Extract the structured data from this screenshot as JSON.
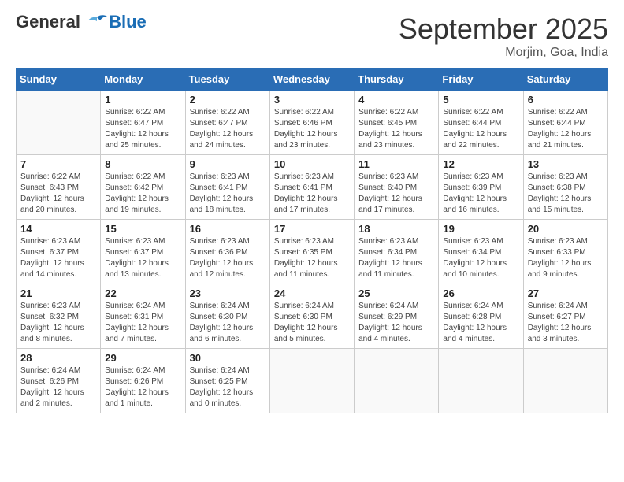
{
  "header": {
    "logo_line1": "General",
    "logo_line2": "Blue",
    "month_title": "September 2025",
    "location": "Morjim, Goa, India"
  },
  "days_of_week": [
    "Sunday",
    "Monday",
    "Tuesday",
    "Wednesday",
    "Thursday",
    "Friday",
    "Saturday"
  ],
  "weeks": [
    [
      {
        "day": "",
        "info": ""
      },
      {
        "day": "1",
        "info": "Sunrise: 6:22 AM\nSunset: 6:47 PM\nDaylight: 12 hours\nand 25 minutes."
      },
      {
        "day": "2",
        "info": "Sunrise: 6:22 AM\nSunset: 6:47 PM\nDaylight: 12 hours\nand 24 minutes."
      },
      {
        "day": "3",
        "info": "Sunrise: 6:22 AM\nSunset: 6:46 PM\nDaylight: 12 hours\nand 23 minutes."
      },
      {
        "day": "4",
        "info": "Sunrise: 6:22 AM\nSunset: 6:45 PM\nDaylight: 12 hours\nand 23 minutes."
      },
      {
        "day": "5",
        "info": "Sunrise: 6:22 AM\nSunset: 6:44 PM\nDaylight: 12 hours\nand 22 minutes."
      },
      {
        "day": "6",
        "info": "Sunrise: 6:22 AM\nSunset: 6:44 PM\nDaylight: 12 hours\nand 21 minutes."
      }
    ],
    [
      {
        "day": "7",
        "info": "Sunrise: 6:22 AM\nSunset: 6:43 PM\nDaylight: 12 hours\nand 20 minutes."
      },
      {
        "day": "8",
        "info": "Sunrise: 6:22 AM\nSunset: 6:42 PM\nDaylight: 12 hours\nand 19 minutes."
      },
      {
        "day": "9",
        "info": "Sunrise: 6:23 AM\nSunset: 6:41 PM\nDaylight: 12 hours\nand 18 minutes."
      },
      {
        "day": "10",
        "info": "Sunrise: 6:23 AM\nSunset: 6:41 PM\nDaylight: 12 hours\nand 17 minutes."
      },
      {
        "day": "11",
        "info": "Sunrise: 6:23 AM\nSunset: 6:40 PM\nDaylight: 12 hours\nand 17 minutes."
      },
      {
        "day": "12",
        "info": "Sunrise: 6:23 AM\nSunset: 6:39 PM\nDaylight: 12 hours\nand 16 minutes."
      },
      {
        "day": "13",
        "info": "Sunrise: 6:23 AM\nSunset: 6:38 PM\nDaylight: 12 hours\nand 15 minutes."
      }
    ],
    [
      {
        "day": "14",
        "info": "Sunrise: 6:23 AM\nSunset: 6:37 PM\nDaylight: 12 hours\nand 14 minutes."
      },
      {
        "day": "15",
        "info": "Sunrise: 6:23 AM\nSunset: 6:37 PM\nDaylight: 12 hours\nand 13 minutes."
      },
      {
        "day": "16",
        "info": "Sunrise: 6:23 AM\nSunset: 6:36 PM\nDaylight: 12 hours\nand 12 minutes."
      },
      {
        "day": "17",
        "info": "Sunrise: 6:23 AM\nSunset: 6:35 PM\nDaylight: 12 hours\nand 11 minutes."
      },
      {
        "day": "18",
        "info": "Sunrise: 6:23 AM\nSunset: 6:34 PM\nDaylight: 12 hours\nand 11 minutes."
      },
      {
        "day": "19",
        "info": "Sunrise: 6:23 AM\nSunset: 6:34 PM\nDaylight: 12 hours\nand 10 minutes."
      },
      {
        "day": "20",
        "info": "Sunrise: 6:23 AM\nSunset: 6:33 PM\nDaylight: 12 hours\nand 9 minutes."
      }
    ],
    [
      {
        "day": "21",
        "info": "Sunrise: 6:23 AM\nSunset: 6:32 PM\nDaylight: 12 hours\nand 8 minutes."
      },
      {
        "day": "22",
        "info": "Sunrise: 6:24 AM\nSunset: 6:31 PM\nDaylight: 12 hours\nand 7 minutes."
      },
      {
        "day": "23",
        "info": "Sunrise: 6:24 AM\nSunset: 6:30 PM\nDaylight: 12 hours\nand 6 minutes."
      },
      {
        "day": "24",
        "info": "Sunrise: 6:24 AM\nSunset: 6:30 PM\nDaylight: 12 hours\nand 5 minutes."
      },
      {
        "day": "25",
        "info": "Sunrise: 6:24 AM\nSunset: 6:29 PM\nDaylight: 12 hours\nand 4 minutes."
      },
      {
        "day": "26",
        "info": "Sunrise: 6:24 AM\nSunset: 6:28 PM\nDaylight: 12 hours\nand 4 minutes."
      },
      {
        "day": "27",
        "info": "Sunrise: 6:24 AM\nSunset: 6:27 PM\nDaylight: 12 hours\nand 3 minutes."
      }
    ],
    [
      {
        "day": "28",
        "info": "Sunrise: 6:24 AM\nSunset: 6:26 PM\nDaylight: 12 hours\nand 2 minutes."
      },
      {
        "day": "29",
        "info": "Sunrise: 6:24 AM\nSunset: 6:26 PM\nDaylight: 12 hours\nand 1 minute."
      },
      {
        "day": "30",
        "info": "Sunrise: 6:24 AM\nSunset: 6:25 PM\nDaylight: 12 hours\nand 0 minutes."
      },
      {
        "day": "",
        "info": ""
      },
      {
        "day": "",
        "info": ""
      },
      {
        "day": "",
        "info": ""
      },
      {
        "day": "",
        "info": ""
      }
    ]
  ]
}
